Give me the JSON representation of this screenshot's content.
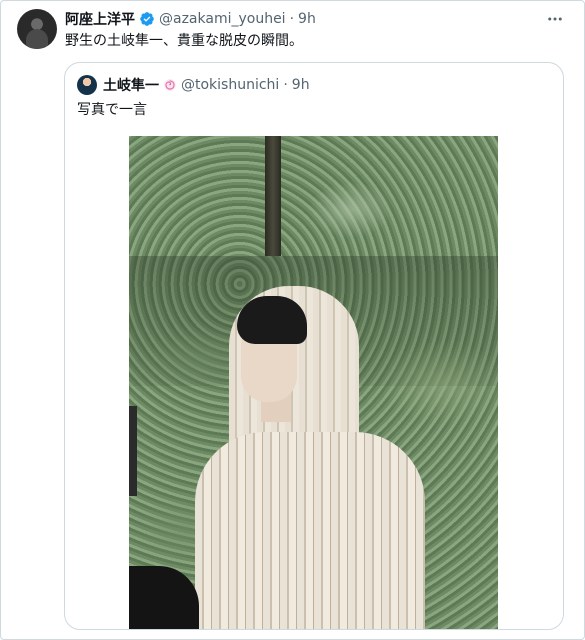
{
  "tweet": {
    "display_name": "阿座上洋平",
    "handle": "@azakami_youhei",
    "separator": "·",
    "time": "9h",
    "text": "野生の土岐隼一、貴重な脱皮の瞬間。",
    "icons": {
      "avatar": "author-avatar",
      "verified": "verified-badge-icon",
      "more": "more-options-icon"
    }
  },
  "quoted_tweet": {
    "display_name": "土岐隼一",
    "handle": "@tokishunichi",
    "separator": "·",
    "time": "9h",
    "text": "写真で一言",
    "icons": {
      "avatar": "quoted-author-avatar",
      "badge": "swirl-badge-icon"
    },
    "photo": "photo of a person in a striped hooded top in front of a hedge"
  },
  "colors": {
    "text_primary": "#0f1419",
    "text_secondary": "#536471",
    "verified_blue": "#1d9bf0",
    "border": "#cfd9de"
  }
}
